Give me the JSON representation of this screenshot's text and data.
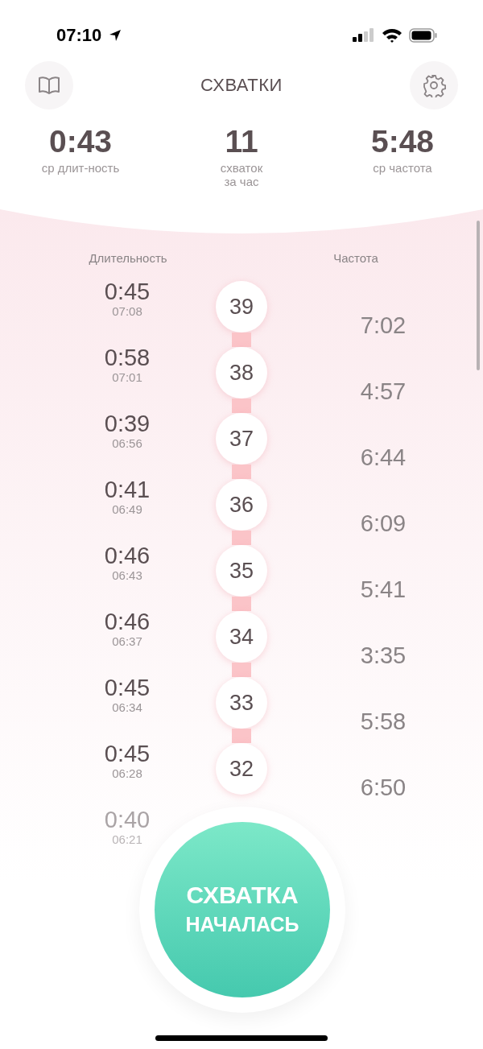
{
  "status_bar": {
    "time": "07:10"
  },
  "header": {
    "title": "СХВАТКИ"
  },
  "stats": [
    {
      "value": "0:43",
      "label": "ср длит-ность"
    },
    {
      "value": "11",
      "label": "схваток\nза час"
    },
    {
      "value": "5:48",
      "label": "ср частота"
    }
  ],
  "columns": {
    "duration": "Длительность",
    "frequency": "Частота"
  },
  "contractions": [
    {
      "number": "39",
      "duration": "0:45",
      "time": "07:08"
    },
    {
      "number": "38",
      "duration": "0:58",
      "time": "07:01"
    },
    {
      "number": "37",
      "duration": "0:39",
      "time": "06:56"
    },
    {
      "number": "36",
      "duration": "0:41",
      "time": "06:49"
    },
    {
      "number": "35",
      "duration": "0:46",
      "time": "06:43"
    },
    {
      "number": "34",
      "duration": "0:46",
      "time": "06:37"
    },
    {
      "number": "33",
      "duration": "0:45",
      "time": "06:34"
    },
    {
      "number": "32",
      "duration": "0:45",
      "time": "06:28"
    },
    {
      "duration": "0:40",
      "time": "06:21"
    }
  ],
  "frequencies": [
    "7:02",
    "4:57",
    "6:44",
    "6:09",
    "5:41",
    "3:35",
    "5:58",
    "6:50"
  ],
  "main_button": {
    "line1": "СХВАТКА",
    "line2": "НАЧАЛАСЬ"
  }
}
